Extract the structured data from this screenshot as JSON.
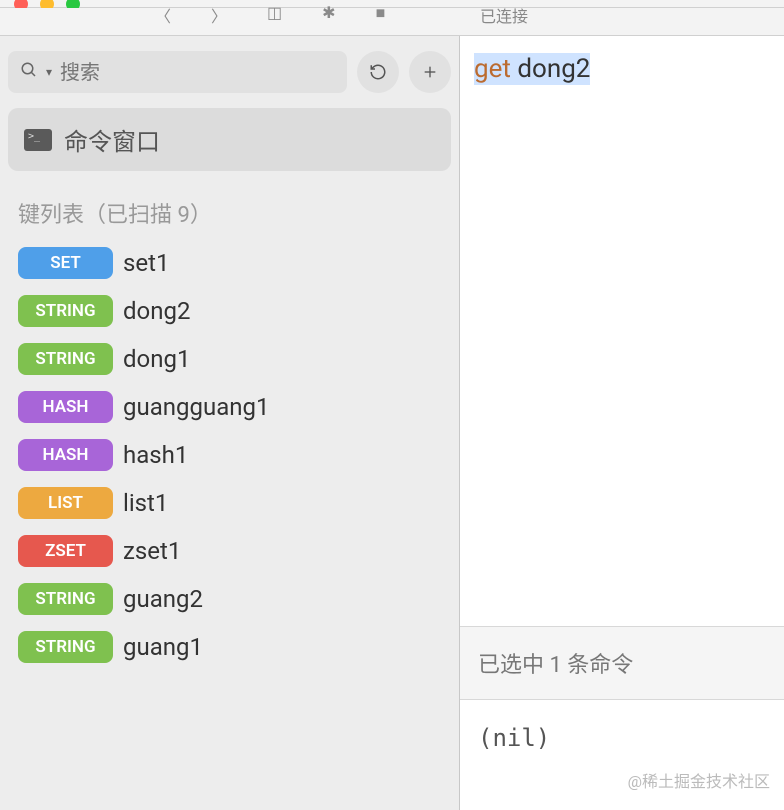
{
  "titlebar": {
    "connection_status": "已连接"
  },
  "search": {
    "placeholder": "搜索"
  },
  "command_window": {
    "label": "命令窗口",
    "icon_prompt": ">_"
  },
  "keylist": {
    "header": "键列表（已扫描 9）",
    "items": [
      {
        "type": "SET",
        "type_class": "type-set",
        "name": "set1"
      },
      {
        "type": "STRING",
        "type_class": "type-string",
        "name": "dong2"
      },
      {
        "type": "STRING",
        "type_class": "type-string",
        "name": "dong1"
      },
      {
        "type": "HASH",
        "type_class": "type-hash",
        "name": "guangguang1"
      },
      {
        "type": "HASH",
        "type_class": "type-hash",
        "name": "hash1"
      },
      {
        "type": "LIST",
        "type_class": "type-list",
        "name": "list1"
      },
      {
        "type": "ZSET",
        "type_class": "type-zset",
        "name": "zset1"
      },
      {
        "type": "STRING",
        "type_class": "type-string",
        "name": "guang2"
      },
      {
        "type": "STRING",
        "type_class": "type-string",
        "name": "guang1"
      }
    ]
  },
  "command": {
    "keyword": "get",
    "arg": "dong2"
  },
  "selection_status": "已选中 1 条命令",
  "result": "(nil)",
  "watermark": "@稀土掘金技术社区"
}
